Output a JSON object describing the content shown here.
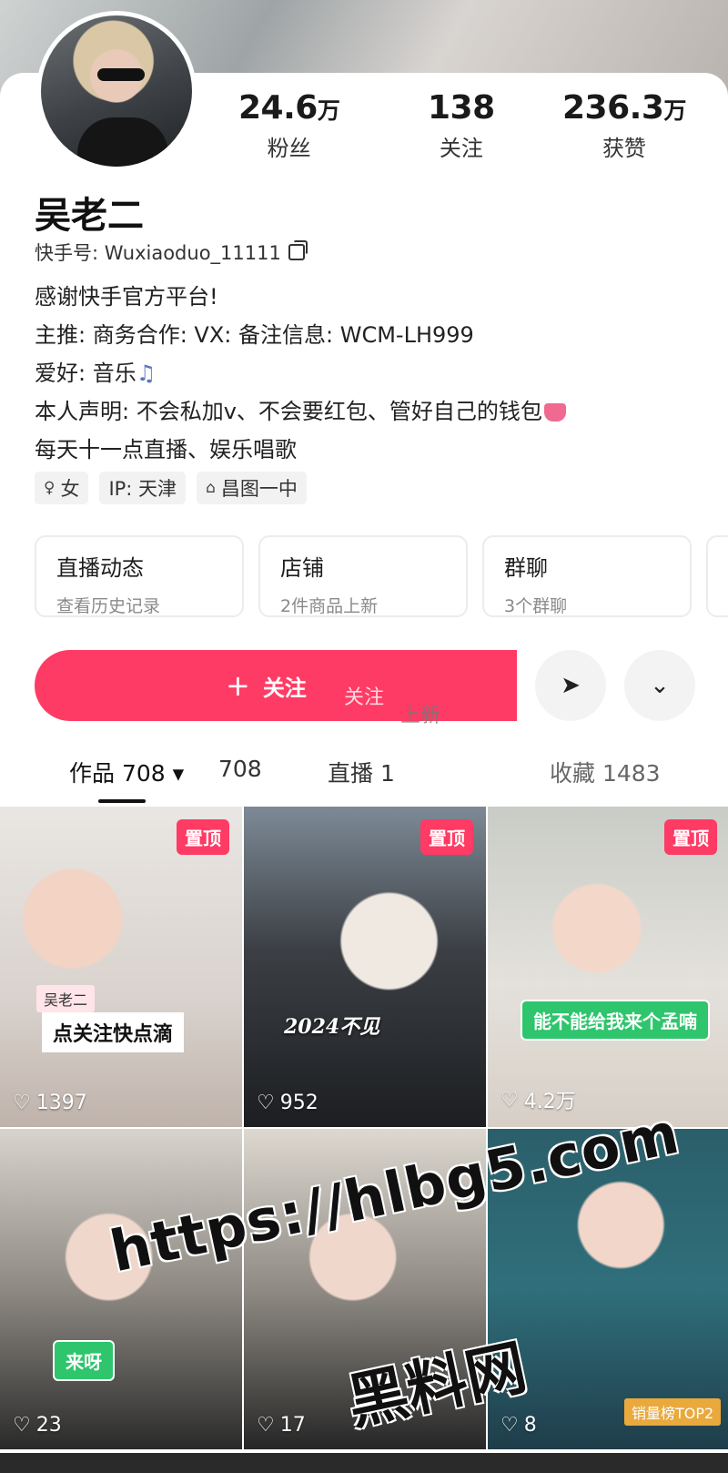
{
  "profile": {
    "name": "吴老二",
    "kuaishou_id": "快手号: Wuxiaoduo_11111",
    "stats": [
      {
        "num": "24.6",
        "unit": "万",
        "label": "粉丝"
      },
      {
        "num": "138",
        "unit": "",
        "label": "关注"
      },
      {
        "num": "236.3",
        "unit": "万",
        "label": "获赞"
      }
    ],
    "bio": [
      "感谢快手官方平台!",
      "主推: 商务合作: VX: 备注信息: WCM-LH999",
      "爱好: 音乐",
      "本人声明: 不会私加v、不会要红包、管好自己的钱包",
      "每天十一点直播、娱乐唱歌"
    ],
    "tags": [
      "女",
      "IP: 天津",
      "昌图一中"
    ]
  },
  "cards": [
    {
      "title": "直播动态",
      "sub": "查看历史记录"
    },
    {
      "title": "店铺",
      "sub": "2件商品上新"
    },
    {
      "title": "群聊",
      "sub": "3个群聊"
    }
  ],
  "actions": {
    "follow_label": "关注",
    "ghost_1": "关注",
    "ghost_2": "上新"
  },
  "tabs": [
    "作品 708",
    "708",
    "直播 1",
    "收藏 1483"
  ],
  "videos": [
    {
      "likes": "1397",
      "pin": "置顶",
      "tag": "吴老二",
      "caption": "点关注快点滴"
    },
    {
      "likes": "952",
      "pin": "置顶",
      "caption": "2024不见"
    },
    {
      "likes": "4.2万",
      "pin": "置顶",
      "caption": "能不能给我来个孟喃"
    },
    {
      "likes": "23",
      "caption": "来呀"
    },
    {
      "likes": "17",
      "caption": ""
    },
    {
      "likes": "8",
      "caption": "销量榜TOP2"
    }
  ],
  "watermark": {
    "url": "https://hlbg5.com",
    "text": "黑料网"
  },
  "colors": {
    "accent": "#fe3b64",
    "green": "#2ec56c"
  }
}
